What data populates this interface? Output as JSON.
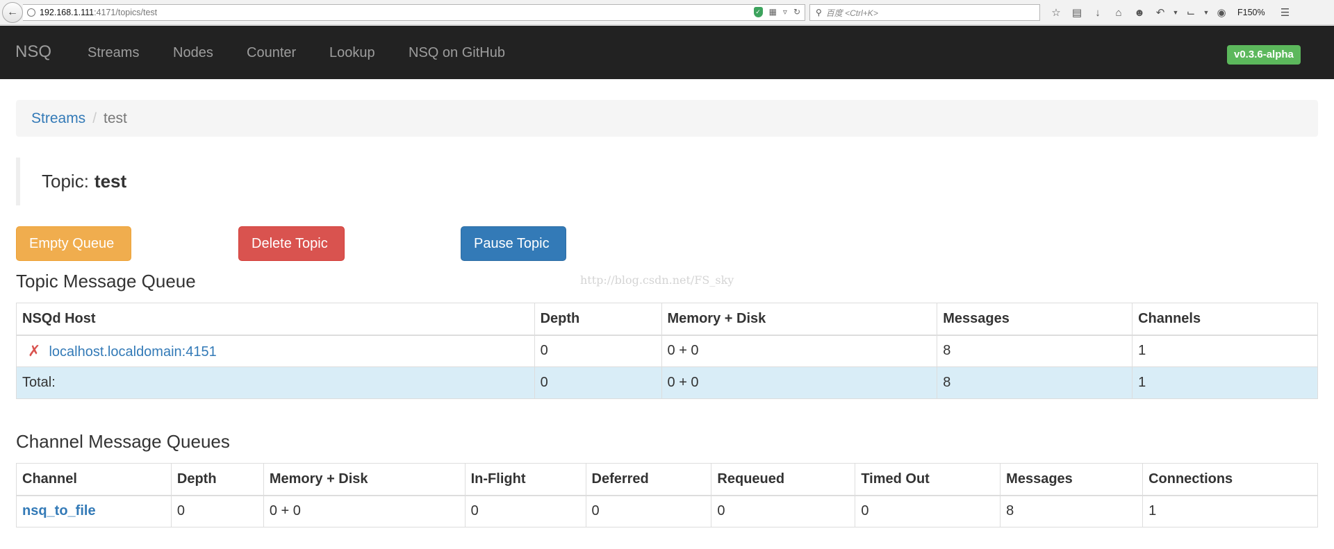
{
  "browser": {
    "url_host": "192.168.1.111",
    "url_rest": ":4171/topics/test",
    "search_placeholder": "百度 <Ctrl+K>",
    "zoom": "F150%"
  },
  "navbar": {
    "brand": "NSQ",
    "items": [
      "Streams",
      "Nodes",
      "Counter",
      "Lookup",
      "NSQ on GitHub"
    ],
    "version": "v0.3.6-alpha"
  },
  "breadcrumb": {
    "parent": "Streams",
    "separator": "/",
    "current": "test"
  },
  "title": {
    "prefix": "Topic:",
    "name": "test"
  },
  "actions": {
    "empty_queue": "Empty Queue",
    "delete_topic": "Delete Topic",
    "pause_topic": "Pause Topic"
  },
  "watermark": "http://blog.csdn.net/FS_sky",
  "topic_queue": {
    "heading": "Topic Message Queue",
    "columns": [
      "NSQd Host",
      "Depth",
      "Memory + Disk",
      "Messages",
      "Channels"
    ],
    "rows": [
      {
        "host": "localhost.localdomain:4151",
        "depth": "0",
        "memory_disk": "0 + 0",
        "messages": "8",
        "channels": "1"
      }
    ],
    "total": {
      "label": "Total:",
      "depth": "0",
      "memory_disk": "0 + 0",
      "messages": "8",
      "channels": "1"
    }
  },
  "channel_queues": {
    "heading": "Channel Message Queues",
    "columns": [
      "Channel",
      "Depth",
      "Memory + Disk",
      "In-Flight",
      "Deferred",
      "Requeued",
      "Timed Out",
      "Messages",
      "Connections"
    ],
    "rows": [
      {
        "channel": "nsq_to_file",
        "depth": "0",
        "memory_disk": "0 + 0",
        "in_flight": "0",
        "deferred": "0",
        "requeued": "0",
        "timed_out": "0",
        "messages": "8",
        "connections": "1"
      }
    ]
  },
  "colors": {
    "navbar": "#222222",
    "badge": "#5cb85c",
    "warning": "#f0ad4e",
    "danger": "#d9534f",
    "primary": "#337ab7",
    "total_row": "#d9edf7"
  }
}
